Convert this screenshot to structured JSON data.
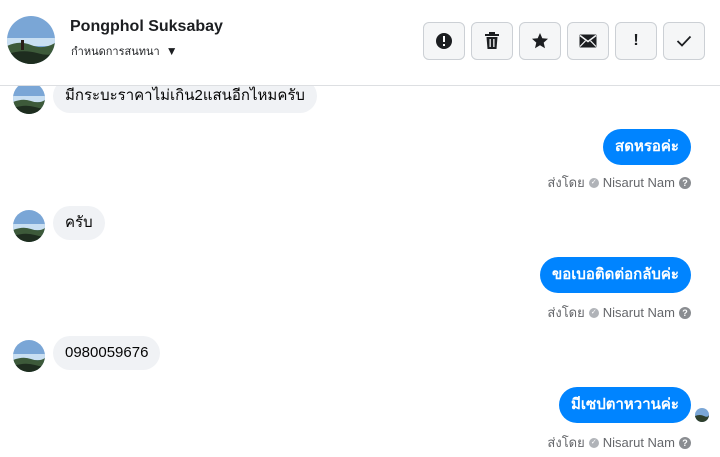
{
  "header": {
    "contact_name": "Pongphol Suksabay",
    "settings_label": "กำหนดการสนทนา",
    "actions": {
      "spam": "report-icon",
      "delete": "trash-icon",
      "star": "star-icon",
      "mark_unread": "envelope-icon",
      "follow_up": "!",
      "done": "check-icon"
    }
  },
  "messages": [
    {
      "direction": "in",
      "text": "มีกระบะราคาไม่เกิน2แสนอีกไหมครับ"
    },
    {
      "direction": "out",
      "text": "สดหรอค่ะ",
      "sent_by_prefix": "ส่งโดย",
      "sender": "Nisarut Nam"
    },
    {
      "direction": "in",
      "text": "ครับ"
    },
    {
      "direction": "out",
      "text": "ขอเบอติดต่อกลับค่ะ",
      "sent_by_prefix": "ส่งโดย",
      "sender": "Nisarut Nam"
    },
    {
      "direction": "in",
      "text": "0980059676"
    },
    {
      "direction": "out",
      "text": "มีเซปตาหวานค่ะ",
      "sent_by_prefix": "ส่งโดย",
      "sender": "Nisarut Nam"
    }
  ],
  "colors": {
    "outgoing_bubble": "#0084ff",
    "incoming_bubble": "#f0f2f5",
    "meta_text": "#65676b"
  }
}
